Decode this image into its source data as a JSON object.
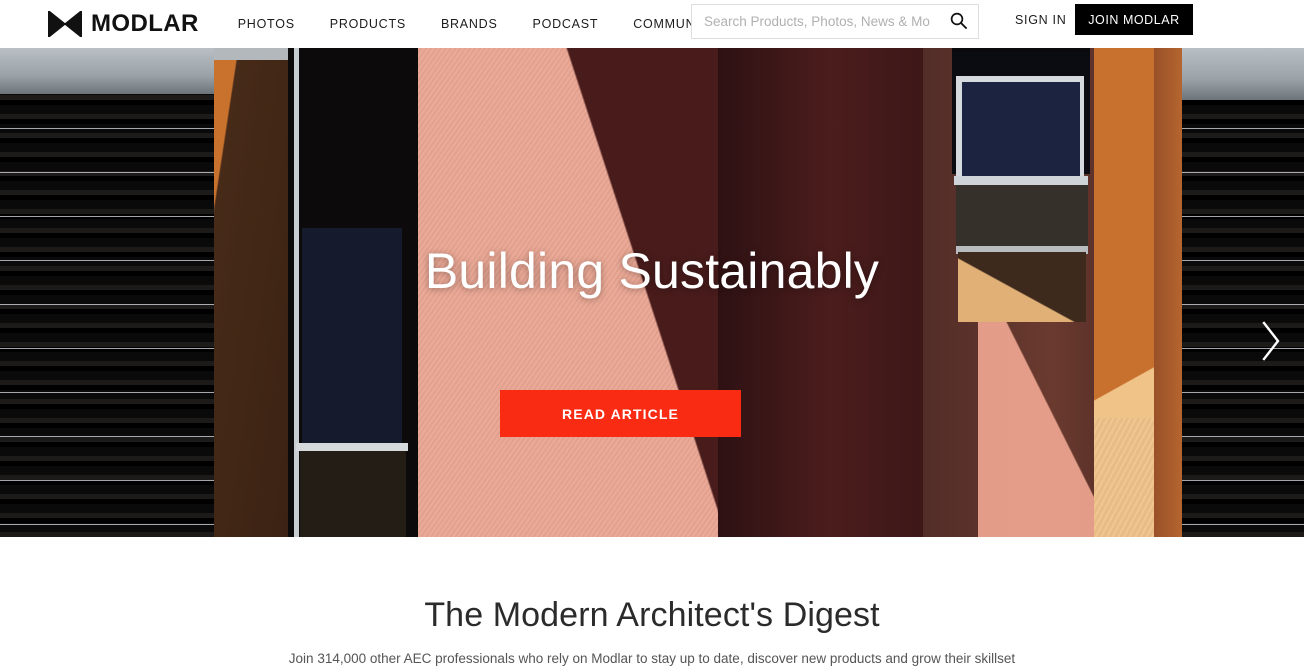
{
  "header": {
    "logo": {
      "icon": "modlar-bowtie-logo-icon",
      "text": "MODLAR"
    },
    "nav": [
      {
        "label": "PHOTOS"
      },
      {
        "label": "PRODUCTS"
      },
      {
        "label": "BRANDS"
      },
      {
        "label": "PODCAST"
      },
      {
        "label": "COMMUNITY"
      }
    ],
    "search": {
      "placeholder": "Search Products, Photos, News & More",
      "value": "",
      "icon": "search-icon"
    },
    "sign_in_label": "SIGN IN",
    "join_label": "JOIN MODLAR"
  },
  "hero": {
    "title": "Building Sustainably",
    "cta_label": "READ ARTICLE",
    "next_icon": "chevron-right-icon",
    "slides": [
      {
        "active": false
      },
      {
        "active": true
      },
      {
        "active": false
      },
      {
        "active": false
      },
      {
        "active": false
      },
      {
        "active": false
      },
      {
        "active": false
      }
    ],
    "active_slide": 2,
    "slide_count": 7
  },
  "digest": {
    "title": "The Modern Architect's Digest",
    "subtitle": "Join 314,000 other AEC professionals who rely on Modlar to stay up to date, discover new products and grow their skillset"
  },
  "colors": {
    "accent_red": "#fa2b13",
    "header_bg": "#ffffff",
    "join_button_bg": "#000000",
    "text_dark": "#1c1c1c"
  }
}
